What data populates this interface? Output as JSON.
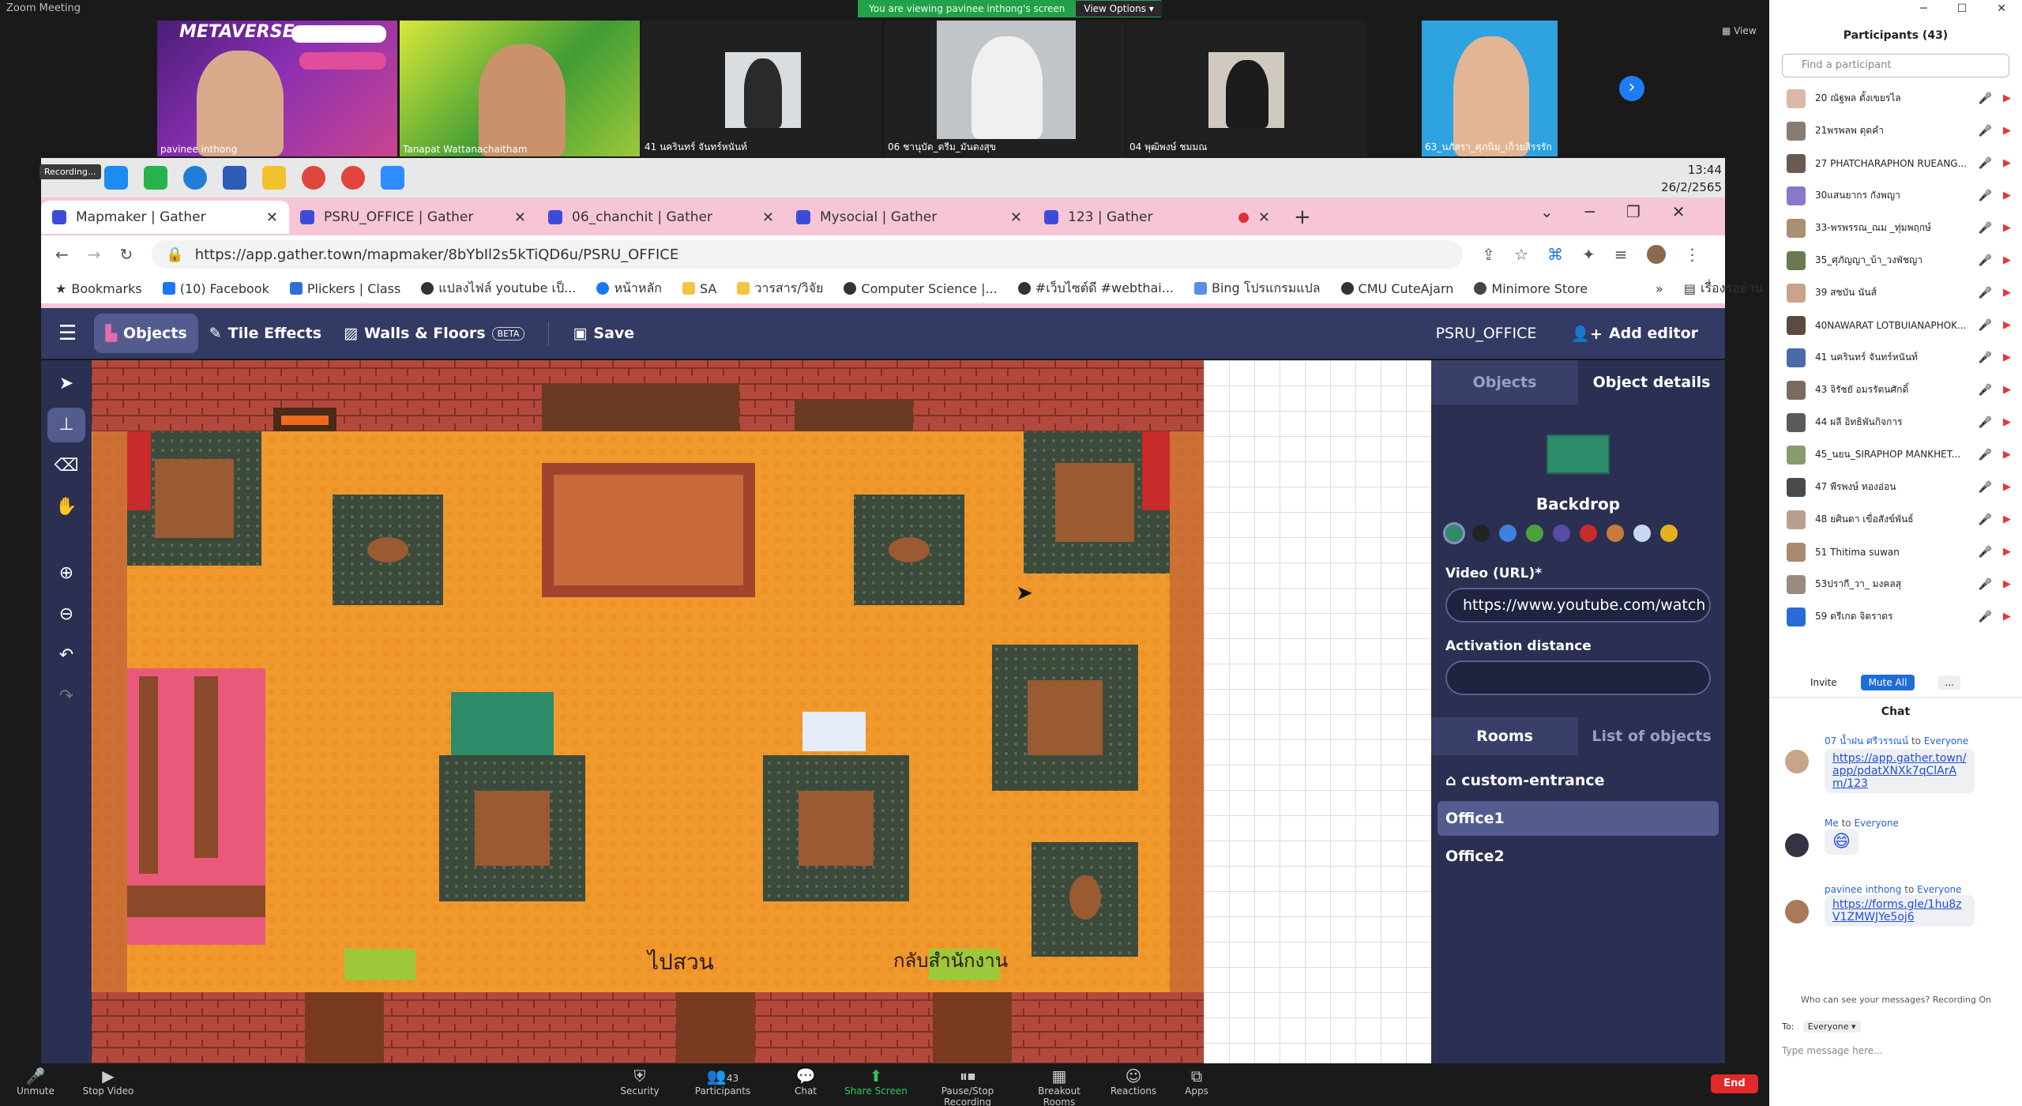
{
  "zoom": {
    "window_title": "Zoom Meeting",
    "banner_text": "You are viewing pavinee inthong's screen",
    "view_options_label": "View Options ▾",
    "view_label": "View",
    "filmstrip": [
      {
        "name": "pavinee inthong",
        "banner": "METAVERSE"
      },
      {
        "name": "Tanapat Wattanachaitham",
        "banner": ""
      },
      {
        "name": "41 นครินทร์ จันทร์หนันท์",
        "banner": ""
      },
      {
        "name": "06 ชานุบัต_ตรีม_มันดงสุข",
        "banner": ""
      },
      {
        "name": "04 พุฒิพงษ์ ชมมณ",
        "banner": ""
      },
      {
        "name": "63_นภัสรา_ศุภนิม_เก็วยสิรรรัก",
        "banner": ""
      }
    ],
    "toolbar": [
      {
        "label": "Unmute",
        "icon": "mic-off-icon"
      },
      {
        "label": "Stop Video",
        "icon": "video-icon"
      },
      {
        "label": "Security",
        "icon": "shield-icon"
      },
      {
        "label": "Participants",
        "icon": "people-icon",
        "count": "43"
      },
      {
        "label": "Chat",
        "icon": "chat-icon"
      },
      {
        "label": "Share Screen",
        "icon": "share-icon"
      },
      {
        "label": "Pause/Stop Recording",
        "icon": "record-icon"
      },
      {
        "label": "Breakout Rooms",
        "icon": "grid-icon"
      },
      {
        "label": "Reactions",
        "icon": "smile-icon"
      },
      {
        "label": "Apps",
        "icon": "apps-icon"
      }
    ],
    "end_label": "End",
    "participants": {
      "title": "Participants (43)",
      "search_placeholder": "Find a participant",
      "list": [
        "20 ณัฐพล ตั้งเขยรไล",
        "21พรพลพ ดุดคำ",
        "27 PHATCHARAPHON RUEANG...",
        "30แสนยากร กังพญา",
        "33-พรพรรณ_ณม _ทุ่มพฤกษ์",
        "35_ศุภัญญา_บ้า_วงพัชญา",
        "39 สชบัน นันส์",
        "40NAWARAT LOTBUIANAPHOK...",
        "41 นครินทร์ จันทร์หนันท์",
        "43 จิรัชยั อมรรัตนศักดิ์",
        "44 ผลี อิทธิพันกิจการ",
        "45_นยน_SIRAPHOP MANKHET...",
        "47 พีรพงษ์ ทองอ่อน",
        "48 ยศินดา เขื่อสังข์พันธ์",
        "51 Thitima suwan",
        "53ปรากี_วา_ มงคลสุ",
        "59 ตรีเกด จิตราดร"
      ],
      "invite_label": "Invite",
      "mute_all_label": "Mute All",
      "more_label": "..."
    },
    "chat": {
      "title": "Chat",
      "messages": [
        {
          "from": "07 น้ำฝน ศรีวรรณน์",
          "to": "Everyone",
          "text": "https://app.gather.town/app/pdatXNXk7qClArAm/123"
        },
        {
          "from": "Me",
          "to": "Everyone",
          "text": "😄"
        },
        {
          "from": "pavinee inthong",
          "to": "Everyone",
          "text": "https://forms.gle/1hu8zV1ZMWJYe5oj6"
        }
      ],
      "to_word": "to",
      "visibility_note": "Who can see your messages? Recording On",
      "to_label": "To:",
      "to_value": "Everyone ▾",
      "input_placeholder": "Type message here..."
    }
  },
  "windows": {
    "clock_time": "13:44",
    "clock_date": "26/2/2565",
    "recording_label": "Recording..."
  },
  "browser": {
    "tabs": [
      {
        "title": "Mapmaker | Gather",
        "active": true
      },
      {
        "title": "PSRU_OFFICE | Gather",
        "active": false
      },
      {
        "title": "06_chanchit | Gather",
        "active": false
      },
      {
        "title": "Mysocial | Gather",
        "active": false
      },
      {
        "title": "123 | Gather",
        "active": false
      }
    ],
    "url": "https://app.gather.town/mapmaker/8bYbIl2s5kTiQD6u/PSRU_OFFICE",
    "bookmarks": [
      "Bookmarks",
      "(10) Facebook",
      "Plickers | Class",
      "แปลงไฟล์ youtube เป็...",
      "หน้าหลัก",
      "SA",
      "วารสาร/วิจัย",
      "Computer Science |...",
      "#เว็บไซต์ดี #webthai...",
      "Bing โปรแกรมแปล",
      "CMU CuteAjarn",
      "Minimore Store"
    ],
    "reading_list": "เรื่องรออ่าน"
  },
  "gather": {
    "menu_icon": "hamburger-icon",
    "toolbar": {
      "objects": "Objects",
      "tile_effects": "Tile Effects",
      "walls_floors": "Walls & Floors",
      "beta": "BETA",
      "save": "Save",
      "space_name": "PSRU_OFFICE",
      "add_editor": "Add editor"
    },
    "map_labels": {
      "label1": "ไปสวน",
      "label2": "กลับสำนักงาน"
    },
    "panel": {
      "tab_objects": "Objects",
      "tab_details": "Object details",
      "object_name": "Backdrop",
      "swatches": [
        "#2e8b6a",
        "#222222",
        "#3d82e0",
        "#4aa33a",
        "#5a4aa8",
        "#c72c2c",
        "#c97a3c",
        "#c9d8f2",
        "#e8b020"
      ],
      "video_label": "Video (URL)*",
      "video_value": "https://www.youtube.com/watch",
      "activation_label": "Activation distance",
      "activation_value": "",
      "rooms_tab": "Rooms",
      "objects_list_tab": "List of objects",
      "rooms": [
        "custom-entrance",
        "Office1",
        "Office2"
      ]
    }
  }
}
